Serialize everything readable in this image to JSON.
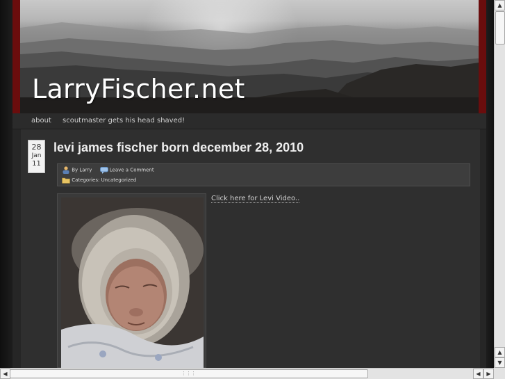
{
  "header": {
    "site_title": "LarryFischer.net"
  },
  "nav": {
    "items": [
      {
        "label": "about"
      },
      {
        "label": "scoutmaster gets his head shaved!"
      }
    ]
  },
  "post": {
    "date": {
      "day": "28",
      "month": "Jan",
      "year": "11"
    },
    "title": "levi james fischer born december 28, 2010",
    "meta": {
      "author": "By Larry",
      "comment_link": "Leave a Comment",
      "categories_label": "Categories:",
      "category": "Uncategorized"
    },
    "video_link": "Click here for Levi Video.."
  },
  "scrollbars": {
    "up_arrow": "▲",
    "down_arrow": "▼",
    "left_arrow": "◀",
    "right_arrow": "▶"
  },
  "colors": {
    "header_border": "#6a0d0d",
    "page_bg": "#262626",
    "content_bg": "#2f2f2f"
  }
}
